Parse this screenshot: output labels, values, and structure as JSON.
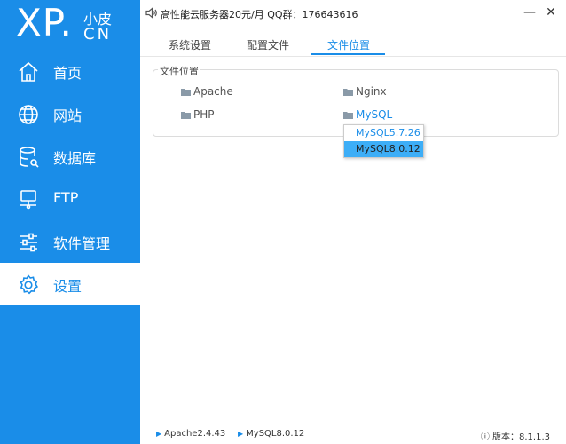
{
  "brand": {
    "logo_main": "XP.",
    "logo_cn_top": "小皮",
    "logo_cn": "CN"
  },
  "sidebar": {
    "items": [
      {
        "label": "首页",
        "icon": "home-icon"
      },
      {
        "label": "网站",
        "icon": "globe-icon"
      },
      {
        "label": "数据库",
        "icon": "database-icon"
      },
      {
        "label": "FTP",
        "icon": "ftp-server-icon"
      },
      {
        "label": "软件管理",
        "icon": "sliders-icon"
      },
      {
        "label": "设置",
        "icon": "gear-icon",
        "active": true
      }
    ]
  },
  "titlebar": {
    "notice": "高性能云服务器20元/月  QQ群：176643616",
    "icons": [
      "speaker-icon",
      "minimize-icon",
      "close-icon"
    ]
  },
  "tabs": [
    {
      "label": "系统设置"
    },
    {
      "label": "配置文件"
    },
    {
      "label": "文件位置",
      "active": true
    }
  ],
  "file_location": {
    "group_title": "文件位置",
    "folders": [
      "Apache",
      "Nginx",
      "PHP",
      "MySQL"
    ],
    "dropdown": [
      "MySQL5.7.26",
      "MySQL8.0.12"
    ],
    "highlighted": "MySQL8.0.12"
  },
  "status": {
    "apache": "Apache2.4.43",
    "mysql": "MySQL8.0.12",
    "version": "版本：8.1.1.3"
  },
  "colors": {
    "accent": "#1a8de8",
    "highlight": "#3daef7"
  }
}
